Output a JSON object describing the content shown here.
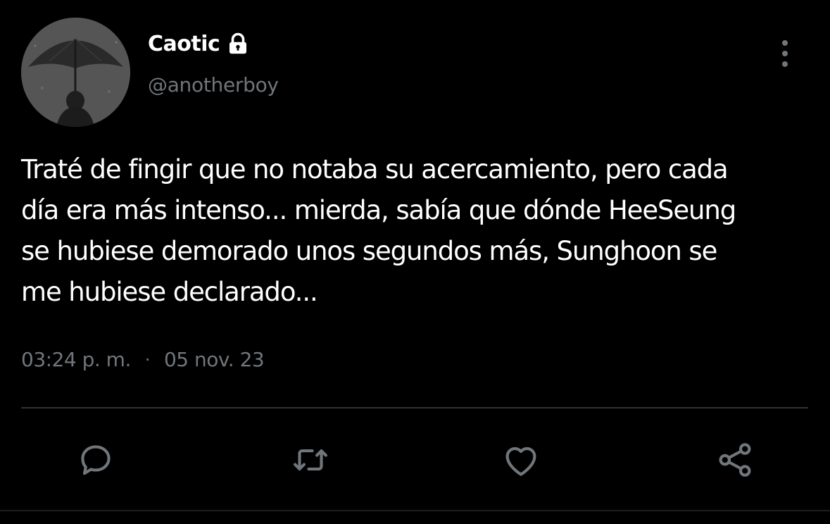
{
  "author": {
    "display_name": "Caotic",
    "handle": "@anotherboy",
    "protected_icon": "lock-icon",
    "avatar": "umbrella-photo-avatar"
  },
  "tweet": {
    "text": "Traté de fingir que no notaba su acercamiento, pero cada\ndía era más intenso... mierda, sabía que dónde HeeSeung\nse hubiese demorado unos segundos más, Sunghoon se\nme hubiese declarado...",
    "time": "03:24 p. m.",
    "separator": "·",
    "date": "05 nov. 23"
  },
  "actions": [
    {
      "name": "reply",
      "icon": "reply-icon"
    },
    {
      "name": "retweet",
      "icon": "retweet-icon"
    },
    {
      "name": "like",
      "icon": "heart-icon"
    },
    {
      "name": "share",
      "icon": "share-icon"
    }
  ],
  "menu": {
    "icon": "more-vertical-icon"
  },
  "colors": {
    "background": "#000000",
    "text_primary": "#ffffff",
    "text_secondary": "#71767b",
    "divider": "#2f3336",
    "icon": "#71767b"
  }
}
